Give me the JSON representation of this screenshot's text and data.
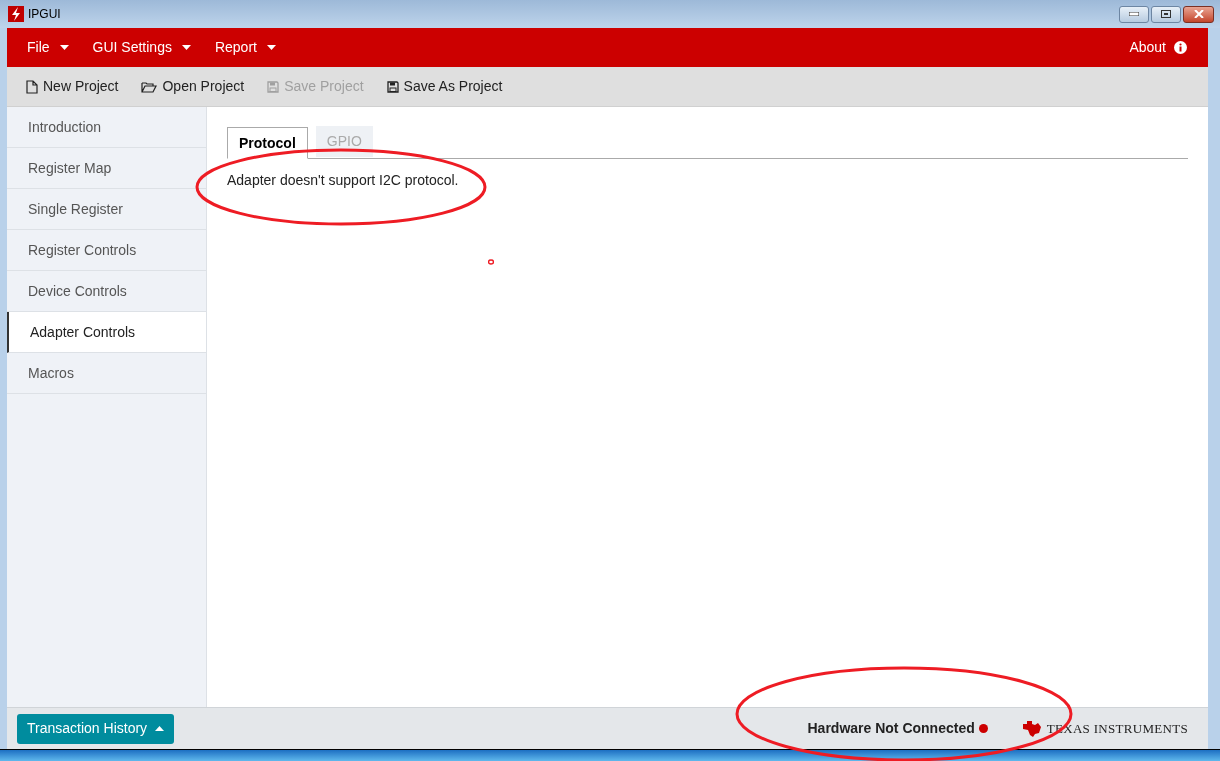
{
  "window": {
    "title": "IPGUI"
  },
  "menu": [
    {
      "label": "File"
    },
    {
      "label": "GUI Settings"
    },
    {
      "label": "Report"
    }
  ],
  "about": "About",
  "toolbar": [
    {
      "label": "New Project",
      "kind": "new",
      "disabled": false
    },
    {
      "label": "Open Project",
      "kind": "open",
      "disabled": false
    },
    {
      "label": "Save Project",
      "kind": "save",
      "disabled": true
    },
    {
      "label": "Save As Project",
      "kind": "save",
      "disabled": false
    }
  ],
  "sidebar": {
    "items": [
      {
        "label": "Introduction",
        "selected": false
      },
      {
        "label": "Register Map",
        "selected": false
      },
      {
        "label": "Single Register",
        "selected": false
      },
      {
        "label": "Register Controls",
        "selected": false
      },
      {
        "label": "Device Controls",
        "selected": false
      },
      {
        "label": "Adapter Controls",
        "selected": true
      },
      {
        "label": "Macros",
        "selected": false
      }
    ]
  },
  "tabs": [
    {
      "label": "Protocol",
      "selected": true
    },
    {
      "label": "GPIO",
      "selected": false
    }
  ],
  "message": "Adapter doesn't support I2C protocol.",
  "status_bar": {
    "history_button": "Transaction History",
    "connection": "Hardware Not Connected",
    "connected": false,
    "logo": "TEXAS INSTRUMENTS"
  }
}
